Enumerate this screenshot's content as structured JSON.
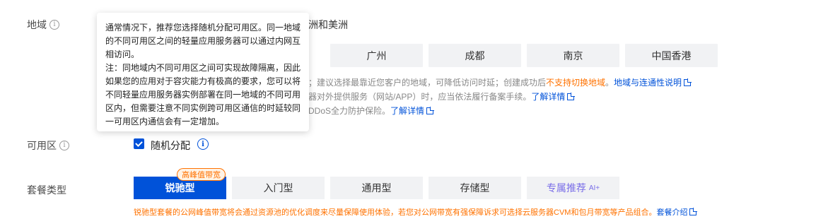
{
  "region": {
    "label": "地域",
    "top_option": "洲和美洲",
    "buttons": [
      "广州",
      "成都",
      "南京",
      "中国香港"
    ],
    "hint1_pre": "；建议选择最靠近您客户的地域，可降低访问时延；创建成功后",
    "hint1_warn": "不支持切换地域",
    "hint1_sep": "。",
    "hint1_link": "地域与连通性说明",
    "hint2_text": "器对外提供服务（网站/APP）时，应当依法履行备案手续。",
    "hint2_link": "了解详情",
    "hint3_text": "DDoS全力防护保险。",
    "hint3_link": "了解详情"
  },
  "tooltip": {
    "para1": "通常情况下，推荐您选择随机分配可用区。同一地域的不同可用区之间的轻量应用服务器可以通过内网互相访问。",
    "para2": "注：同地域内不同可用区之间可实现故障隔离，因此如果您的应用对于容灾能力有极高的要求，您可以将不同轻量应用服务器实例部署在同一地域的不同可用区内，但需要注意不同实例跨可用区通信的时延较同一可用区内通信会有一定增加。"
  },
  "zone": {
    "label": "可用区",
    "checkbox_label": "随机分配"
  },
  "plan": {
    "label": "套餐类型",
    "badge": "高峰值带宽",
    "options": [
      "锐驰型",
      "入门型",
      "通用型",
      "存储型",
      "专属推荐"
    ],
    "ai_tag": "AI+",
    "hint": "锐驰型套餐的公网峰值带宽将会通过资源池的优化调度来尽量保障使用体验，若您对公网带宽有强保障诉求可选择云服务器CVM和包月带宽等产品组合。",
    "hint_link": "套餐介绍"
  },
  "colors": {
    "primary": "#0052d9",
    "warning": "#ff7200",
    "ai": "#7a6ee8"
  }
}
